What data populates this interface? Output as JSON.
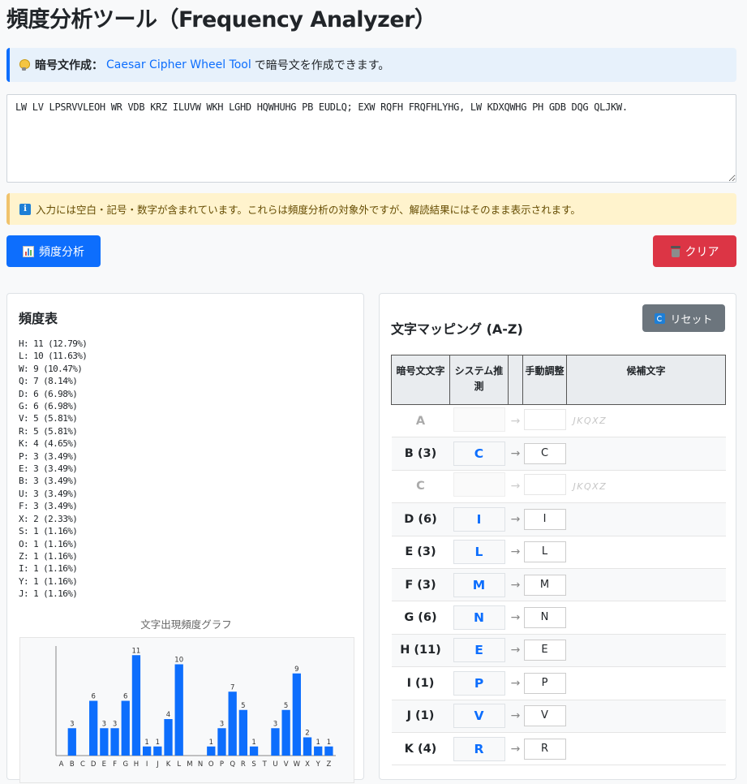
{
  "page_title": "頻度分析ツール（Frequency Analyzer）",
  "tip": {
    "icon": "lightbulb-icon",
    "label": "暗号文作成：",
    "link_text": "Caesar Cipher Wheel Tool",
    "suffix": "で暗号文を作成できます。"
  },
  "input": {
    "value": "LW LV LPSRVVLEOH WR VDB KRZ ILUVW WKH LGHD HQWHUHG PB EUDLQ; EXW RQFH FRQFHLYHG, LW KDXQWHG PH GDB DQG QLJKW."
  },
  "notice": {
    "icon": "info-icon",
    "text": "入力には空白・記号・数字が含まれています。これらは頻度分析の対象外ですが、解読結果にはそのまま表示されます。"
  },
  "buttons": {
    "analyze": "頻度分析",
    "clear": "クリア",
    "reset": "リセット"
  },
  "freq_panel": {
    "title": "頻度表",
    "lines": [
      "H: 11 (12.79%)",
      "L: 10 (11.63%)",
      "W: 9 (10.47%)",
      "Q: 7 (8.14%)",
      "D: 6 (6.98%)",
      "G: 6 (6.98%)",
      "V: 5 (5.81%)",
      "R: 5 (5.81%)",
      "K: 4 (4.65%)",
      "P: 3 (3.49%)",
      "E: 3 (3.49%)",
      "B: 3 (3.49%)",
      "U: 3 (3.49%)",
      "F: 3 (3.49%)",
      "X: 2 (2.33%)",
      "S: 1 (1.16%)",
      "O: 1 (1.16%)",
      "Z: 1 (1.16%)",
      "I: 1 (1.16%)",
      "Y: 1 (1.16%)",
      "J: 1 (1.16%)"
    ],
    "chart_title": "文字出現頻度グラフ"
  },
  "chart_data": {
    "type": "bar",
    "title": "文字出現頻度グラフ",
    "categories": [
      "A",
      "B",
      "C",
      "D",
      "E",
      "F",
      "G",
      "H",
      "I",
      "J",
      "K",
      "L",
      "M",
      "N",
      "O",
      "P",
      "Q",
      "R",
      "S",
      "T",
      "U",
      "V",
      "W",
      "X",
      "Y",
      "Z"
    ],
    "values": [
      0,
      3,
      0,
      6,
      3,
      3,
      6,
      11,
      1,
      1,
      4,
      10,
      0,
      0,
      1,
      3,
      7,
      5,
      1,
      0,
      3,
      5,
      9,
      2,
      1,
      1
    ],
    "ylim": [
      0,
      12
    ],
    "grid": false,
    "bar_color": "#0d6efd"
  },
  "mapping": {
    "title": "文字マッピング (A-Z)",
    "headers": [
      "暗号文文字",
      "システム推測",
      "",
      "手動調整",
      "候補文字"
    ],
    "arrow": "→",
    "rows": [
      {
        "cipher": "A",
        "sys": "",
        "manual": "",
        "cand": "JKQXZ",
        "dim": true
      },
      {
        "cipher": "B (3)",
        "sys": "C",
        "manual": "C",
        "cand": "",
        "dim": false
      },
      {
        "cipher": "C",
        "sys": "",
        "manual": "",
        "cand": "JKQXZ",
        "dim": true
      },
      {
        "cipher": "D (6)",
        "sys": "I",
        "manual": "I",
        "cand": "",
        "dim": false
      },
      {
        "cipher": "E (3)",
        "sys": "L",
        "manual": "L",
        "cand": "",
        "dim": false
      },
      {
        "cipher": "F (3)",
        "sys": "M",
        "manual": "M",
        "cand": "",
        "dim": false
      },
      {
        "cipher": "G (6)",
        "sys": "N",
        "manual": "N",
        "cand": "",
        "dim": false
      },
      {
        "cipher": "H (11)",
        "sys": "E",
        "manual": "E",
        "cand": "",
        "dim": false
      },
      {
        "cipher": "I (1)",
        "sys": "P",
        "manual": "P",
        "cand": "",
        "dim": false
      },
      {
        "cipher": "J (1)",
        "sys": "V",
        "manual": "V",
        "cand": "",
        "dim": false
      },
      {
        "cipher": "K (4)",
        "sys": "R",
        "manual": "R",
        "cand": "",
        "dim": false
      }
    ]
  }
}
